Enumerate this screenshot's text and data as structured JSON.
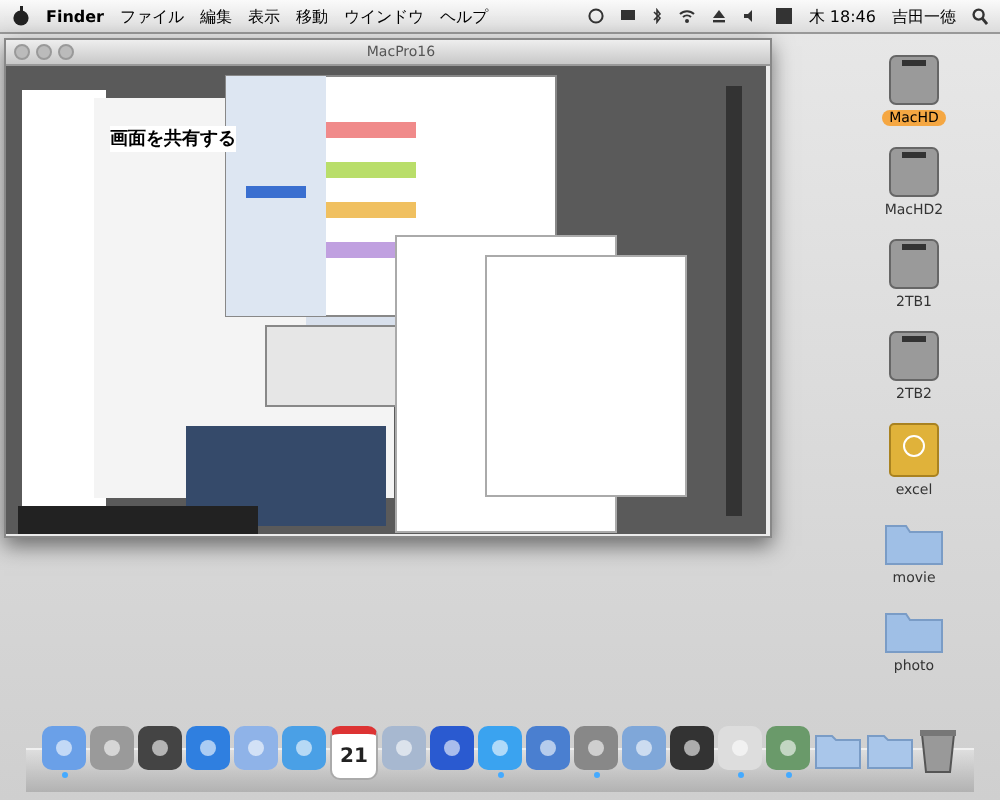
{
  "menu_bar": {
    "app": "Finder",
    "items": [
      "ファイル",
      "編集",
      "表示",
      "移動",
      "ウインドウ",
      "ヘルプ"
    ],
    "clock": "木 18:46",
    "user": "吉田一徳"
  },
  "window": {
    "title": "MacPro16",
    "heading": "画面を共有する"
  },
  "desktop_icons": [
    {
      "label": "MacHD",
      "kind": "drive",
      "selected": true
    },
    {
      "label": "MacHD2",
      "kind": "drive",
      "selected": false
    },
    {
      "label": "2TB1",
      "kind": "drive",
      "selected": false
    },
    {
      "label": "2TB2",
      "kind": "drive",
      "selected": false
    },
    {
      "label": "excel",
      "kind": "firewire",
      "selected": false
    },
    {
      "label": "movie",
      "kind": "folder",
      "selected": false
    },
    {
      "label": "photo",
      "kind": "folder",
      "selected": false
    }
  ],
  "dock": [
    {
      "kind": "finder",
      "running": true
    },
    {
      "kind": "rocket",
      "running": false
    },
    {
      "kind": "dashboard",
      "running": false
    },
    {
      "kind": "appstore",
      "running": false
    },
    {
      "kind": "bird",
      "running": false
    },
    {
      "kind": "compass",
      "running": false
    },
    {
      "kind": "calendar",
      "label": "21",
      "running": false
    },
    {
      "kind": "photos",
      "running": false
    },
    {
      "kind": "music",
      "running": false
    },
    {
      "kind": "quicktime",
      "running": true
    },
    {
      "kind": "hammer",
      "running": false
    },
    {
      "kind": "gear",
      "running": true
    },
    {
      "kind": "cross",
      "running": false
    },
    {
      "kind": "camera",
      "running": false
    },
    {
      "kind": "script",
      "running": true
    },
    {
      "kind": "screen",
      "running": true
    },
    {
      "kind": "folder",
      "running": false
    },
    {
      "kind": "folder",
      "running": false
    },
    {
      "kind": "trash",
      "running": false
    }
  ]
}
